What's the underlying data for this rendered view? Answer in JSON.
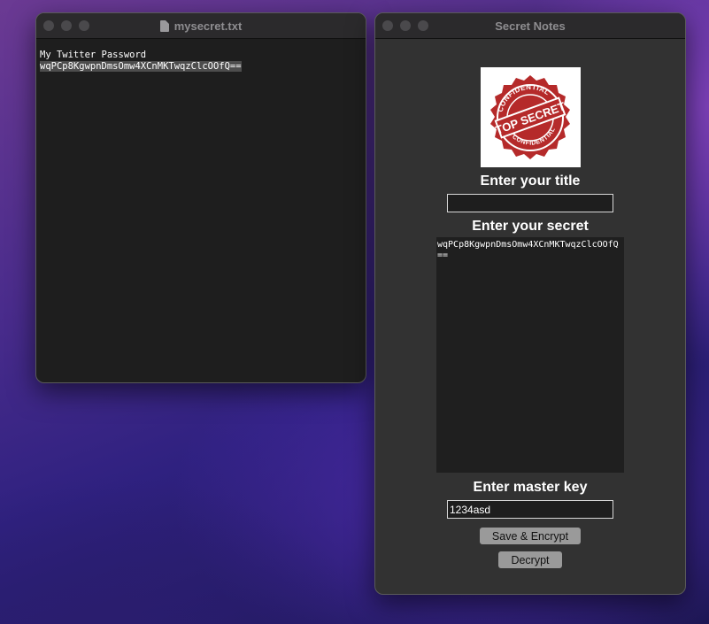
{
  "left_window": {
    "title": "mysecret.txt",
    "lines": [
      "My Twitter Password",
      "wqPCp8KgwpnDmsOmw4XCnMKTwqzClcOOfQ=="
    ]
  },
  "right_window": {
    "title": "Secret Notes",
    "logo": {
      "top_text": "CONFIDENTIAL",
      "main_text": "TOP SECRET",
      "bottom_text": "CONFIDENTIAL"
    },
    "title_label": "Enter your title",
    "title_value": "",
    "secret_label": "Enter your secret",
    "secret_value": "wqPCp8KgwpnDmsOmw4XCnMKTwqzClcOOfQ==",
    "master_key_label": "Enter master key",
    "master_key_value": "1234asd",
    "save_button": "Save & Encrypt",
    "decrypt_button": "Decrypt"
  },
  "colors": {
    "stamp_red": "#b52a2a",
    "window_bg": "#323232",
    "editor_bg": "#1e1e1e"
  }
}
